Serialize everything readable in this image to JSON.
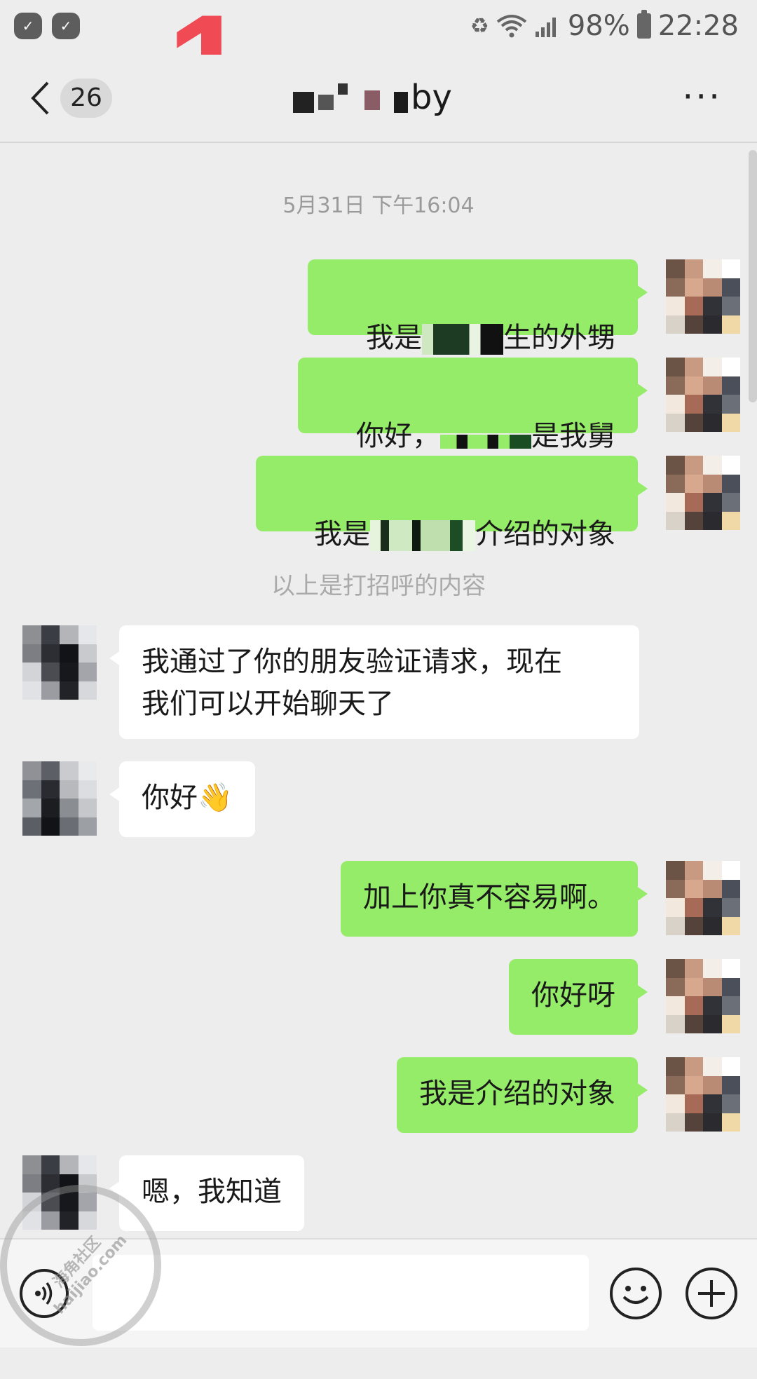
{
  "status_bar": {
    "battery": "98%",
    "time": "22:28"
  },
  "overlay_number": "1",
  "nav": {
    "unread_count": "26",
    "title_visible_suffix": "by"
  },
  "chat": {
    "timestamp": "5月31日 下午16:04",
    "system_note": "以上是打招呼的内容",
    "messages": [
      {
        "dir": "out",
        "pre": "我是",
        "post": "生的外甥"
      },
      {
        "dir": "out",
        "pre": "你好，",
        "post": "是我舅"
      },
      {
        "dir": "out",
        "pre": "我是",
        "post": "介绍的对象"
      },
      {
        "dir": "in",
        "text": "我通过了你的朋友验证请求，现在\n我们可以开始聊天了"
      },
      {
        "dir": "in",
        "text": "你好👋"
      },
      {
        "dir": "out",
        "text": "加上你真不容易啊。"
      },
      {
        "dir": "out",
        "text": "你好呀"
      },
      {
        "dir": "out",
        "text": "我是介绍的对象"
      },
      {
        "dir": "in",
        "text": "嗯，我知道"
      }
    ]
  },
  "input": {
    "value": "",
    "emoji_label": "😊",
    "plus_label": "+"
  },
  "watermark": {
    "line1": "海角社区",
    "line2": "haijiao.com"
  },
  "icons": [
    "back-chevron-icon",
    "more-dots-icon",
    "voice-icon",
    "emoji-icon",
    "plus-icon",
    "wifi-icon",
    "signal-icon",
    "battery-icon"
  ]
}
